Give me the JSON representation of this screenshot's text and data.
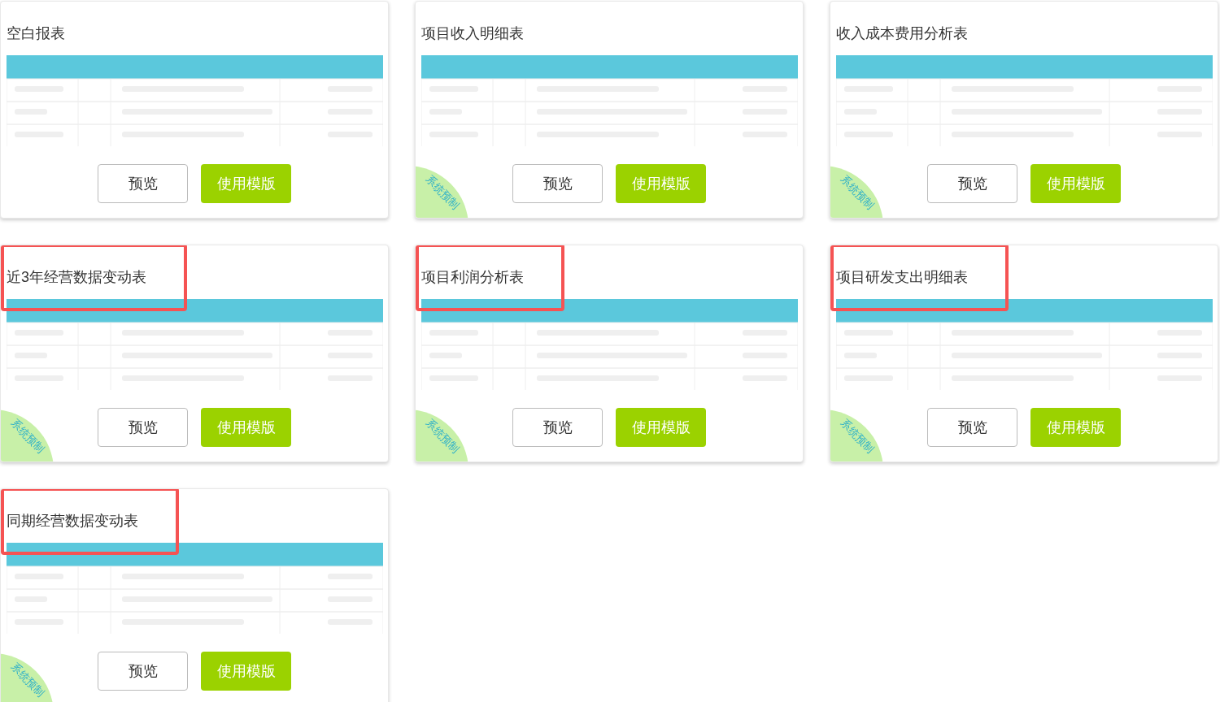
{
  "cards": [
    {
      "title": "空白报表",
      "highlighted": false,
      "buttons": [
        "预览",
        "使用模版"
      ]
    },
    {
      "title": "项目收入明细表",
      "highlighted": false,
      "badge": "系统预制",
      "buttons": [
        "预览",
        "使用模版"
      ]
    },
    {
      "title": "收入成本费用分析表",
      "highlighted": false,
      "badge": "系统预制",
      "buttons": [
        "预览",
        "使用模版"
      ]
    },
    {
      "title": "近3年经营数据变动表",
      "highlighted": true,
      "badge": "系统预制",
      "buttons": [
        "预览",
        "使用模版"
      ]
    },
    {
      "title": "项目利润分析表",
      "highlighted": true,
      "badge": "系统预制",
      "buttons": [
        "预览",
        "使用模版"
      ]
    },
    {
      "title": "项目研发支出明细表",
      "highlighted": true,
      "badge": "系统预制",
      "buttons": [
        "预览",
        "使用模版"
      ]
    },
    {
      "title": "同期经营数据变动表",
      "highlighted": true,
      "badge": "系统预制",
      "buttons": [
        "预览",
        "使用模版"
      ]
    }
  ]
}
